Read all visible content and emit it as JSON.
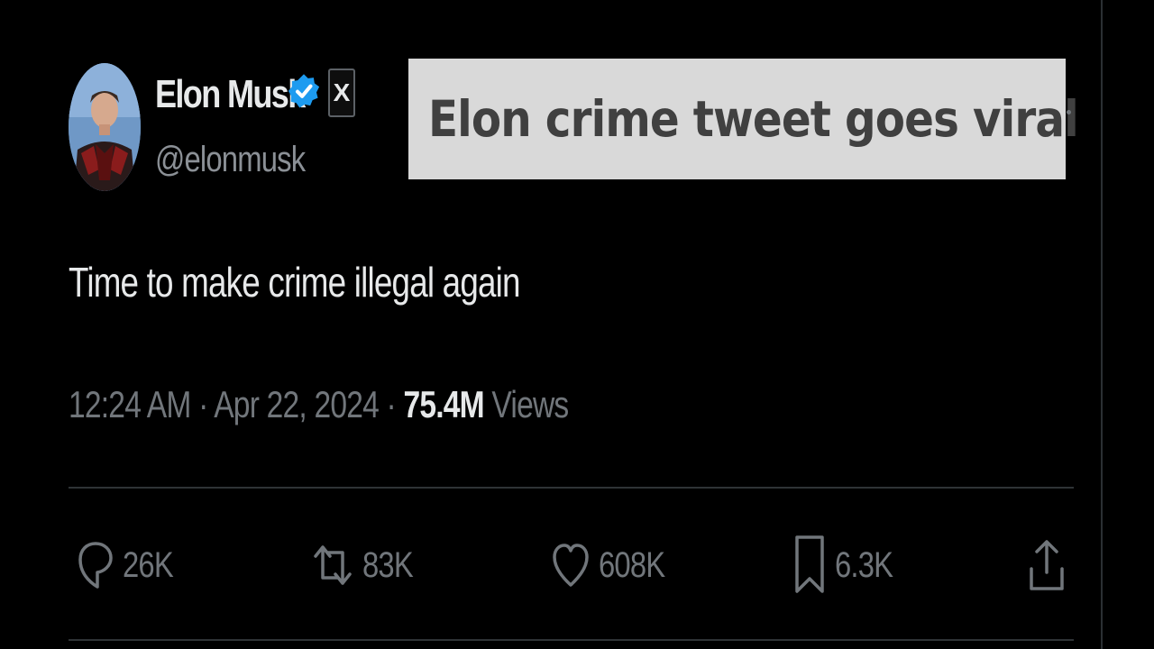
{
  "caption": {
    "text": "Elon crime tweet goes viral"
  },
  "author": {
    "name": "Elon Musk",
    "handle": "@elonmusk",
    "verified_color": "#1d9bf0",
    "affiliation_badge": "X"
  },
  "tweet": {
    "text": "Time to make crime illegal again",
    "time": "12:24 AM",
    "separator": "·",
    "date": "Apr 22, 2024",
    "views_count": "75.4M",
    "views_label": "Views"
  },
  "actions": {
    "replies": {
      "icon": "reply-icon",
      "count": "26K"
    },
    "reposts": {
      "icon": "repost-icon",
      "count": "83K"
    },
    "likes": {
      "icon": "heart-icon",
      "count": "608K"
    },
    "bookmarks": {
      "icon": "bookmark-icon",
      "count": "6.3K"
    },
    "share": {
      "icon": "share-icon"
    }
  },
  "colors": {
    "background": "#000000",
    "primary_text": "#e7e9ea",
    "secondary_text": "#71767b",
    "divider": "#2f3336",
    "caption_bg": "#d9d9d9",
    "caption_text": "#404040"
  }
}
